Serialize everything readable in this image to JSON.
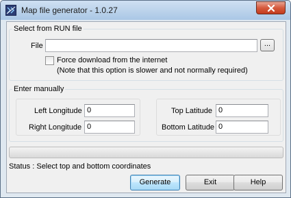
{
  "window": {
    "title": "Map file generator - 1.0.27"
  },
  "run_file_group": {
    "label": "Select from RUN file",
    "file_label": "File",
    "file_value": "",
    "browse_label": "...",
    "force_download_label": "Force download from the internet",
    "force_download_checked": false,
    "note": "(Note that this option is slower and not normally required)"
  },
  "manual_group": {
    "label": "Enter manually",
    "left_longitude_label": "Left Longitude",
    "left_longitude_value": "0",
    "right_longitude_label": "Right Longitude",
    "right_longitude_value": "0",
    "top_latitude_label": "Top Latitude",
    "top_latitude_value": "0",
    "bottom_latitude_label": "Bottom Latitude",
    "bottom_latitude_value": "0"
  },
  "progress": {
    "fraction": 0
  },
  "status": {
    "text": "Status : Select top and bottom coordinates"
  },
  "buttons": {
    "generate": "Generate",
    "exit": "Exit",
    "help": "Help"
  }
}
